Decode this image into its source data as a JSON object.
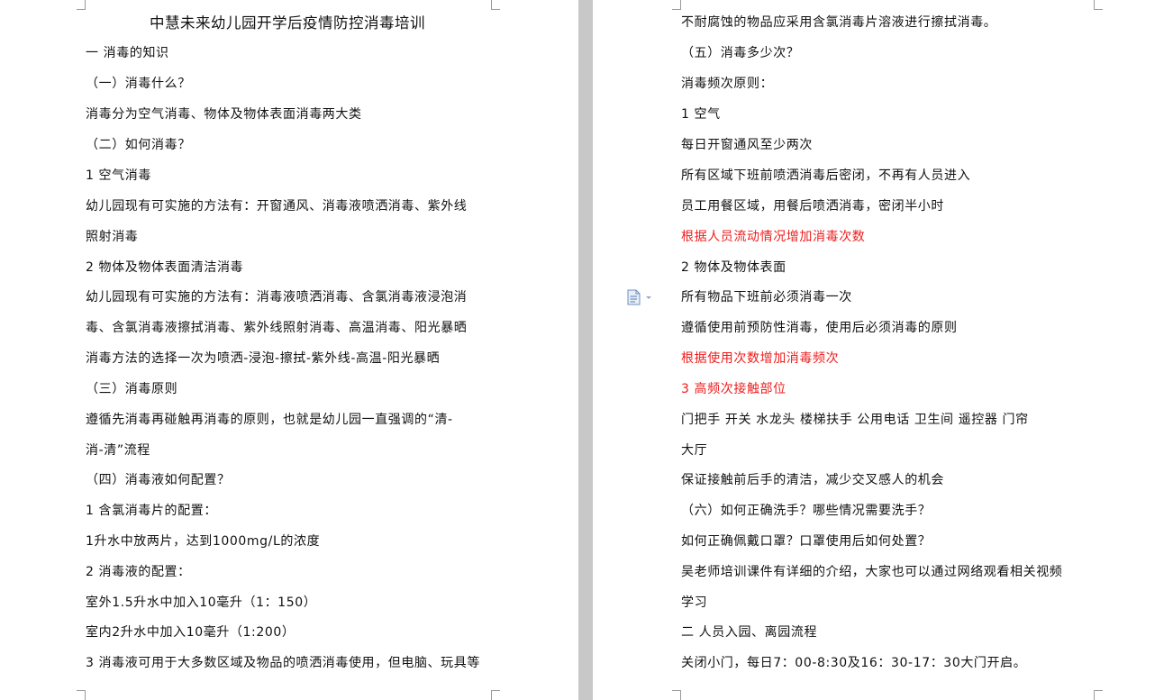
{
  "left_page": {
    "title": "中慧未来幼儿园开学后疫情防控消毒培训",
    "lines": [
      "一 消毒的知识",
      "（一）消毒什么？",
      " 消毒分为空气消毒、物体及物体表面消毒两大类",
      "（二）如何消毒？",
      "1 空气消毒",
      "  幼儿园现有可实施的方法有：开窗通风、消毒液喷洒消毒、紫外线",
      "照射消毒",
      "2 物体及物体表面清洁消毒",
      "  幼儿园现有可实施的方法有：消毒液喷洒消毒、含氯消毒液浸泡消",
      "毒、含氯消毒液擦拭消毒、紫外线照射消毒、高温消毒、阳光暴晒",
      "  消毒方法的选择一次为喷洒-浸泡-擦拭-紫外线-高温-阳光暴晒",
      "（三）消毒原则",
      " 遵循先消毒再碰触再消毒的原则，也就是幼儿园一直强调的“清-",
      "消-清”流程",
      "（四）消毒液如何配置？",
      "1 含氯消毒片的配置：",
      "  1升水中放两片，达到1000mg/L的浓度",
      "2 消毒液的配置：",
      "  室外1.5升水中加入10毫升（1：150）",
      "  室内2升水中加入10毫升（1:200）",
      "3 消毒液可用于大多数区域及物品的喷洒消毒使用，但电脑、玩具等"
    ]
  },
  "right_page": {
    "lines": [
      "不耐腐蚀的物品应采用含氯消毒片溶液进行擦拭消毒。",
      "（五）消毒多少次？",
      "消毒频次原则：",
      "1 空气",
      "  每日开窗通风至少两次",
      "  所有区域下班前喷洒消毒后密闭，不再有人员进入",
      "  员工用餐区域，用餐后喷洒消毒，密闭半小时",
      "  根据人员流动情况增加消毒次数",
      "2 物体及物体表面",
      "  所有物品下班前必须消毒一次",
      "  遵循使用前预防性消毒，使用后必须消毒的原则",
      "  根据使用次数增加消毒频次",
      "3 高频次接触部位",
      "  门把手 开关 水龙头 楼梯扶手 公用电话 卫生间 遥控器 门帘",
      "大厅",
      "  保证接触前后手的清洁，减少交叉感人的机会",
      " （六）如何正确洗手？哪些情况需要洗手？",
      "      如何正确佩戴口罩？口罩使用后如何处置？",
      "  吴老师培训课件有详细的介绍，大家也可以通过网络观看相关视频",
      "学习",
      "二 人员入园、离园流程",
      "    关闭小门，每日7：00-8:30及16：30-17：30大门开启。"
    ],
    "red_line_indices": [
      7,
      11,
      12
    ]
  },
  "icons": {
    "margin": "document-options-icon"
  },
  "colors": {
    "text": "#111111",
    "emphasis": "#ee1c1c",
    "gutter": "#c8c8c8"
  }
}
